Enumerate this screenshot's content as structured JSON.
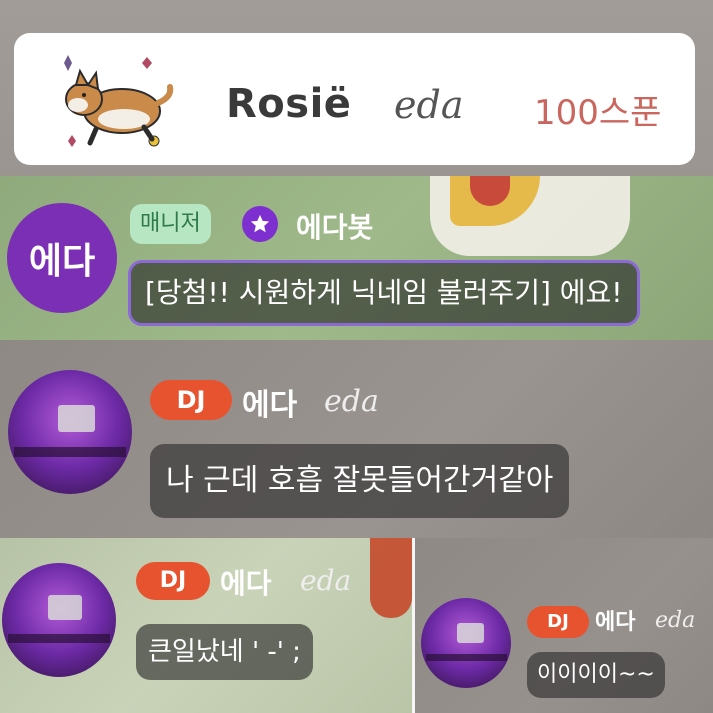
{
  "banner": {
    "sender_name": "Rosië",
    "sender_script": "eda",
    "amount": "100스푼",
    "icon": "corgi-sticker-icon"
  },
  "bot_message": {
    "avatar_text": "에다",
    "role_badge": "매니저",
    "role_icon": "star-icon",
    "bot_name": "에다봇",
    "message": "[당첨!! 시원하게 닉네임 불러주기] 에요!",
    "colors": {
      "avatar": "#7b2fb5",
      "badge_bg": "#b7e6c2",
      "bubble_border": "#8b6ad6"
    }
  },
  "messages": [
    {
      "badge": "DJ",
      "nickname": "에다",
      "nickname_script": "eda",
      "text": "나 근데 호흡 잘못들어간거같아"
    },
    {
      "badge": "DJ",
      "nickname": "에다",
      "nickname_script": "eda",
      "text": "큰일났네 ' -' ;"
    },
    {
      "badge": "DJ",
      "nickname": "에다",
      "nickname_script": "eda",
      "text": "이이이이~~"
    }
  ],
  "colors": {
    "dj_badge": "#e8532f",
    "amount": "#c9665e"
  }
}
